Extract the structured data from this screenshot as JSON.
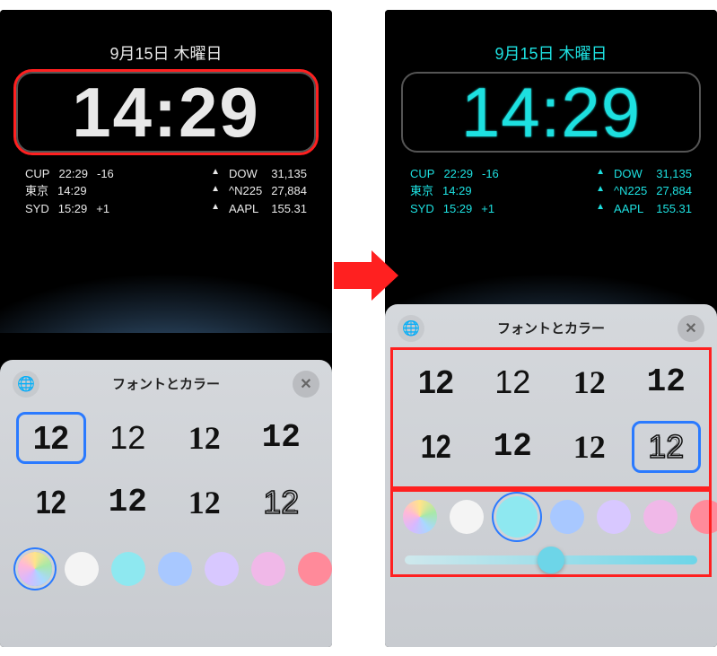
{
  "date": "9月15日 木曜日",
  "time": "14:29",
  "stocks": {
    "left": [
      {
        "sym": "CUP",
        "t": "22:29",
        "v": "-16"
      },
      {
        "sym": "東京",
        "t": "14:29",
        "v": ""
      },
      {
        "sym": "SYD",
        "t": "15:29",
        "v": "+1"
      }
    ],
    "right": [
      {
        "name": "DOW",
        "val": "31,135"
      },
      {
        "name": "^N225",
        "val": "27,884"
      },
      {
        "name": "AAPL",
        "val": "155.31"
      }
    ]
  },
  "panel": {
    "title": "フォントとカラー",
    "sample": "12",
    "fonts": [
      "bold",
      "light",
      "serif",
      "slab",
      "condensed",
      "slab2",
      "serif2",
      "outline"
    ],
    "selected_left": 0,
    "selected_right": 7,
    "colors": [
      "multi",
      "white",
      "cyan",
      "blue",
      "purple",
      "pink",
      "red"
    ],
    "color_selected_left": 0,
    "color_selected_right": 2,
    "slider_pct": 50
  }
}
